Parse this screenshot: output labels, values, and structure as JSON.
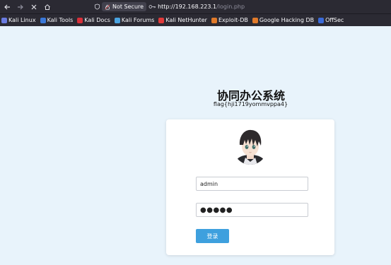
{
  "browser": {
    "security_label": "Not Secure",
    "url_host": "http://192.168.223.1",
    "url_path": "/login.php",
    "bookmarks": [
      {
        "label": "Kali Linux",
        "icon": "kali-icon",
        "color": "#6a7be0"
      },
      {
        "label": "Kali Tools",
        "icon": "kali-tools-icon",
        "color": "#3a78d8"
      },
      {
        "label": "Kali Docs",
        "icon": "kali-docs-icon",
        "color": "#d8303a"
      },
      {
        "label": "Kali Forums",
        "icon": "kali-forums-icon",
        "color": "#4aa3e0"
      },
      {
        "label": "Kali NetHunter",
        "icon": "nethunter-icon",
        "color": "#e03a3a"
      },
      {
        "label": "Exploit-DB",
        "icon": "exploit-db-icon",
        "color": "#e07a2a"
      },
      {
        "label": "Google Hacking DB",
        "icon": "ghdb-icon",
        "color": "#e07a2a"
      },
      {
        "label": "OffSec",
        "icon": "offsec-icon",
        "color": "#3a6ad8"
      }
    ]
  },
  "page": {
    "title": "协同办公系统",
    "flag": "flag{hji1719yommvppa4}"
  },
  "login": {
    "username_value": "admin",
    "password_value": "●●●●●",
    "button_label": "登录",
    "button_color": "#3ea0de"
  }
}
